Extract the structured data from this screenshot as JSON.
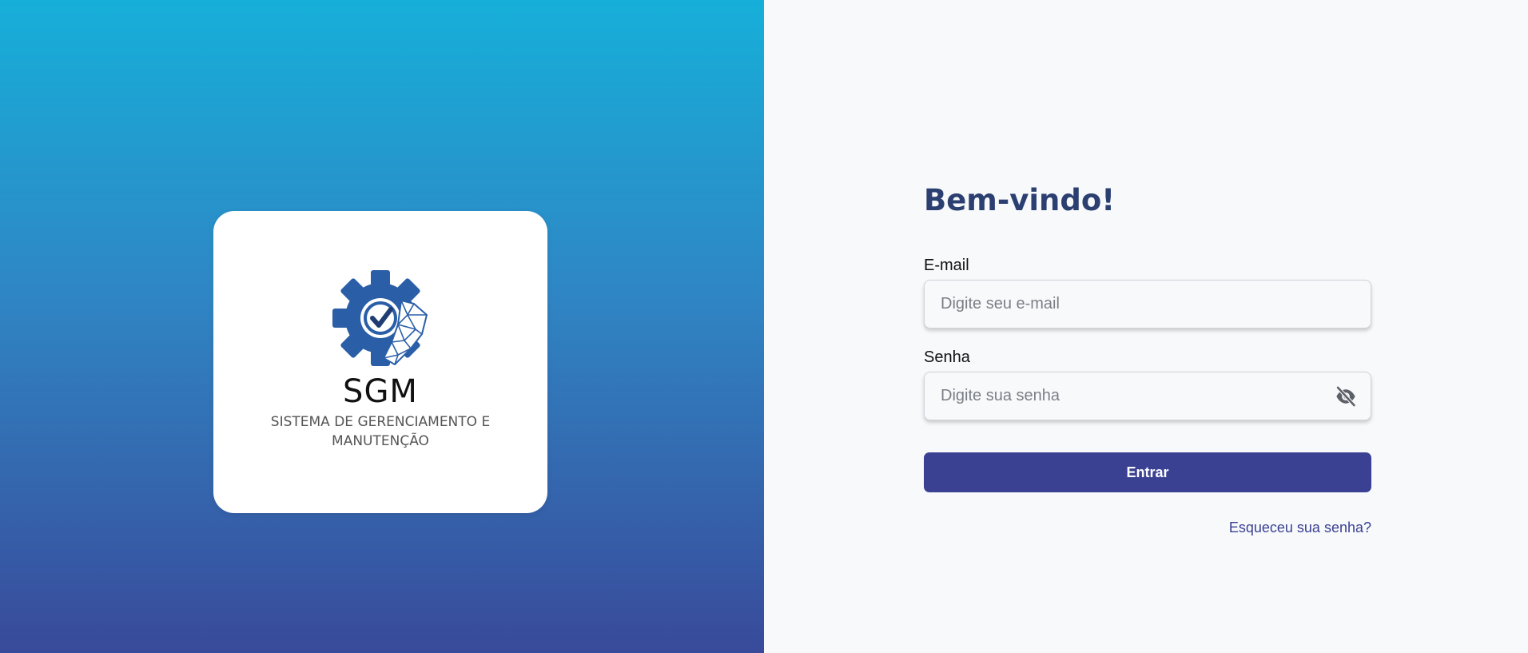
{
  "brand": {
    "name": "SGM",
    "subtitle": "SISTEMA DE GERENCIAMENTO E MANUTENÇÃO",
    "logo_icon": "gear-check-icon",
    "colors": {
      "gradient_top": "#16afd9",
      "gradient_bottom": "#394a9a",
      "logo_blue": "#2a5fa8"
    }
  },
  "login": {
    "title": "Bem-vindo!",
    "email_label": "E-mail",
    "email_placeholder": "Digite seu e-mail",
    "email_value": "",
    "password_label": "Senha",
    "password_placeholder": "Digite sua senha",
    "password_value": "",
    "password_toggle_icon": "eye-off-icon",
    "submit_label": "Entrar",
    "forgot_link": "Esqueceu sua senha?",
    "colors": {
      "title": "#2b3f70",
      "button": "#3a4193",
      "link": "#3a4193"
    }
  }
}
